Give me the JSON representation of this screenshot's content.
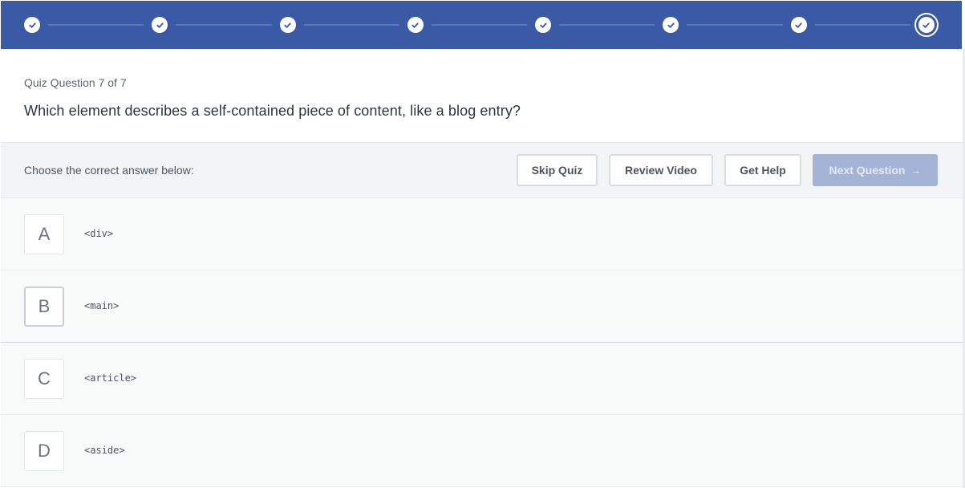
{
  "progress": {
    "total_steps": 8,
    "completed_steps": 7,
    "current_step": 8
  },
  "question": {
    "count_label": "Quiz Question 7 of 7",
    "text": "Which element describes a self-contained piece of content, like a blog entry?"
  },
  "toolbar": {
    "instruction": "Choose the correct answer below:",
    "skip_label": "Skip Quiz",
    "review_label": "Review Video",
    "help_label": "Get Help",
    "next_label": "Next Question",
    "next_arrow": "→"
  },
  "answers": [
    {
      "letter": "A",
      "code": "<div>"
    },
    {
      "letter": "B",
      "code": "<main>"
    },
    {
      "letter": "C",
      "code": "<article>"
    },
    {
      "letter": "D",
      "code": "<aside>"
    }
  ],
  "colors": {
    "header_bg": "#3a5aa5",
    "next_disabled_bg": "#a3b4d6",
    "toolbar_bg": "#f2f4f6"
  }
}
